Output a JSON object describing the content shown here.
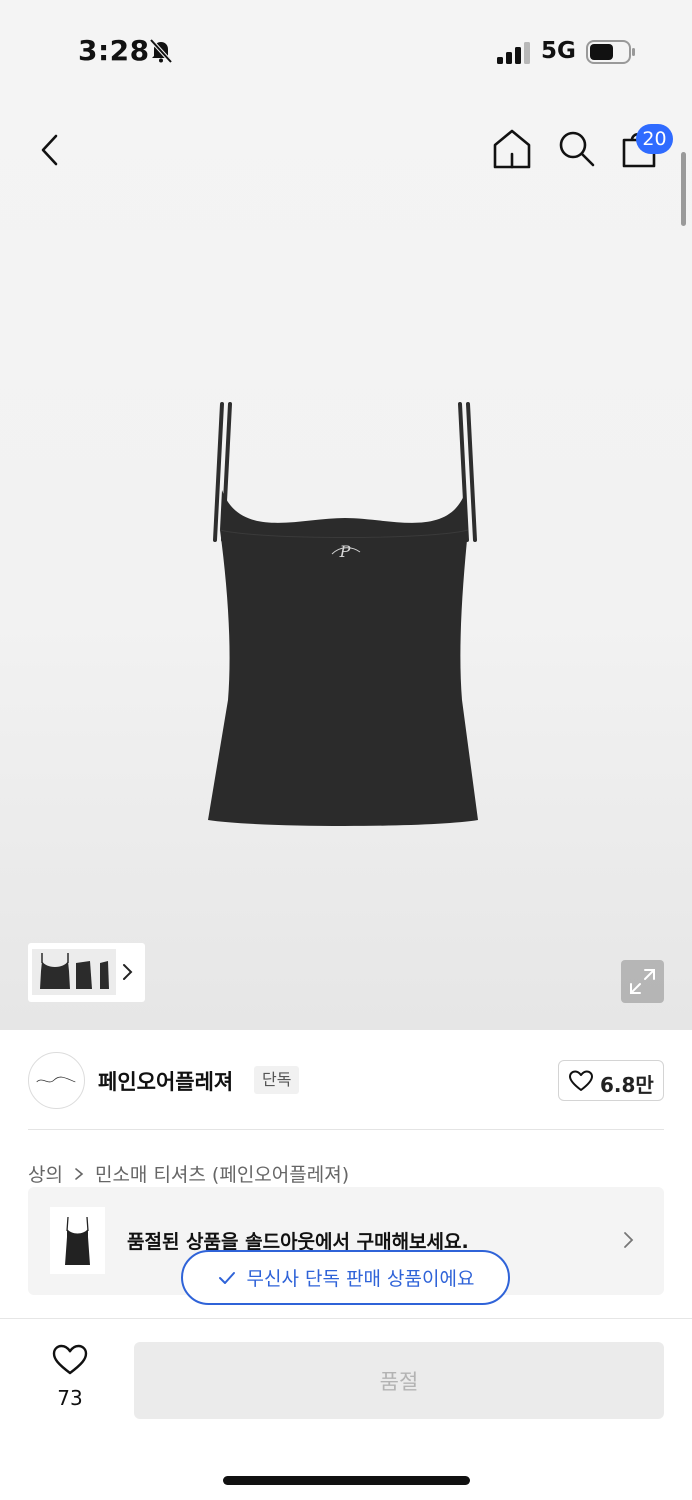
{
  "status_bar": {
    "time": "3:28",
    "network": "5G"
  },
  "header": {
    "cart_count": "20"
  },
  "brand": {
    "name": "페인오어플레져",
    "tag": "단독",
    "like_count": "6.8만",
    "logo_text": "Pain or pleasure"
  },
  "breadcrumb": {
    "category": "상의",
    "subcategory": "민소매 티셔츠 (페인오어플레져)"
  },
  "soldout_banner": {
    "text": "품절된 상품을 솔드아웃에서 구매해보세요."
  },
  "exclusive_badge": {
    "text": "무신사 단독 판매 상품이에요"
  },
  "footer": {
    "wish_count": "73",
    "buy_button_label": "품절"
  },
  "colors": {
    "accent_blue": "#2f63d8",
    "badge_blue": "#2f6bff",
    "disabled_gray": "#ebebeb"
  }
}
